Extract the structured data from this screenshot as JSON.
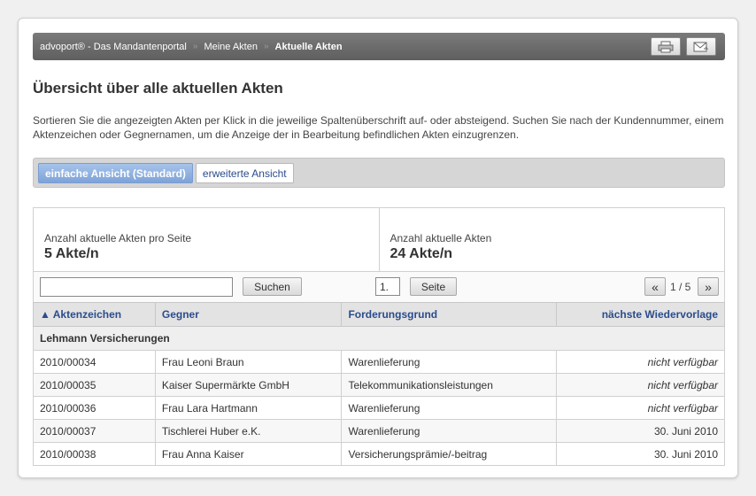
{
  "breadcrumb": {
    "items": [
      "advoport® - Das Mandantenportal",
      "Meine Akten"
    ],
    "current": "Aktuelle Akten",
    "separator": "»"
  },
  "page": {
    "title": "Übersicht über alle aktuellen Akten",
    "intro": "Sortieren Sie die angezeigten Akten per Klick in die jeweilige Spaltenüberschrift auf- oder absteigend. Suchen Sie nach der Kundennummer, einem Aktenzeichen oder Gegnernamen, um die Anzeige der in Bearbeitung befindlichen Akten einzugrenzen."
  },
  "views": {
    "simple": "einfache Ansicht (Standard)",
    "extended": "erweiterte Ansicht"
  },
  "stats": {
    "per_page_label": "Anzahl aktuelle Akten pro Seite",
    "per_page_value": "5 Akte/n",
    "total_label": "Anzahl aktuelle Akten",
    "total_value": "24 Akte/n"
  },
  "toolbar": {
    "search_value": "",
    "search_button": "Suchen",
    "page_value": "1.",
    "page_button": "Seite",
    "prev": "«",
    "page_info": "1 / 5",
    "next": "»"
  },
  "table": {
    "headers": [
      "▲ Aktenzeichen",
      "Gegner",
      "Forderungsgrund",
      "nächste Wiedervorlage"
    ],
    "group": "Lehmann Versicherungen",
    "rows": [
      [
        "2010/00034",
        "Frau Leoni Braun",
        "Warenlieferung",
        "nicht verfügbar"
      ],
      [
        "2010/00035",
        "Kaiser Supermärkte GmbH",
        "Telekommunikationsleistungen",
        "nicht verfügbar"
      ],
      [
        "2010/00036",
        "Frau Lara Hartmann",
        "Warenlieferung",
        "nicht verfügbar"
      ],
      [
        "2010/00037",
        "Tischlerei Huber e.K.",
        "Warenlieferung",
        "30. Juni 2010"
      ],
      [
        "2010/00038",
        "Frau Anna Kaiser",
        "Versicherungsprämie/-beitrag",
        "30. Juni 2010"
      ]
    ]
  },
  "icons": {
    "print": "printer-icon",
    "email": "email-icon"
  }
}
